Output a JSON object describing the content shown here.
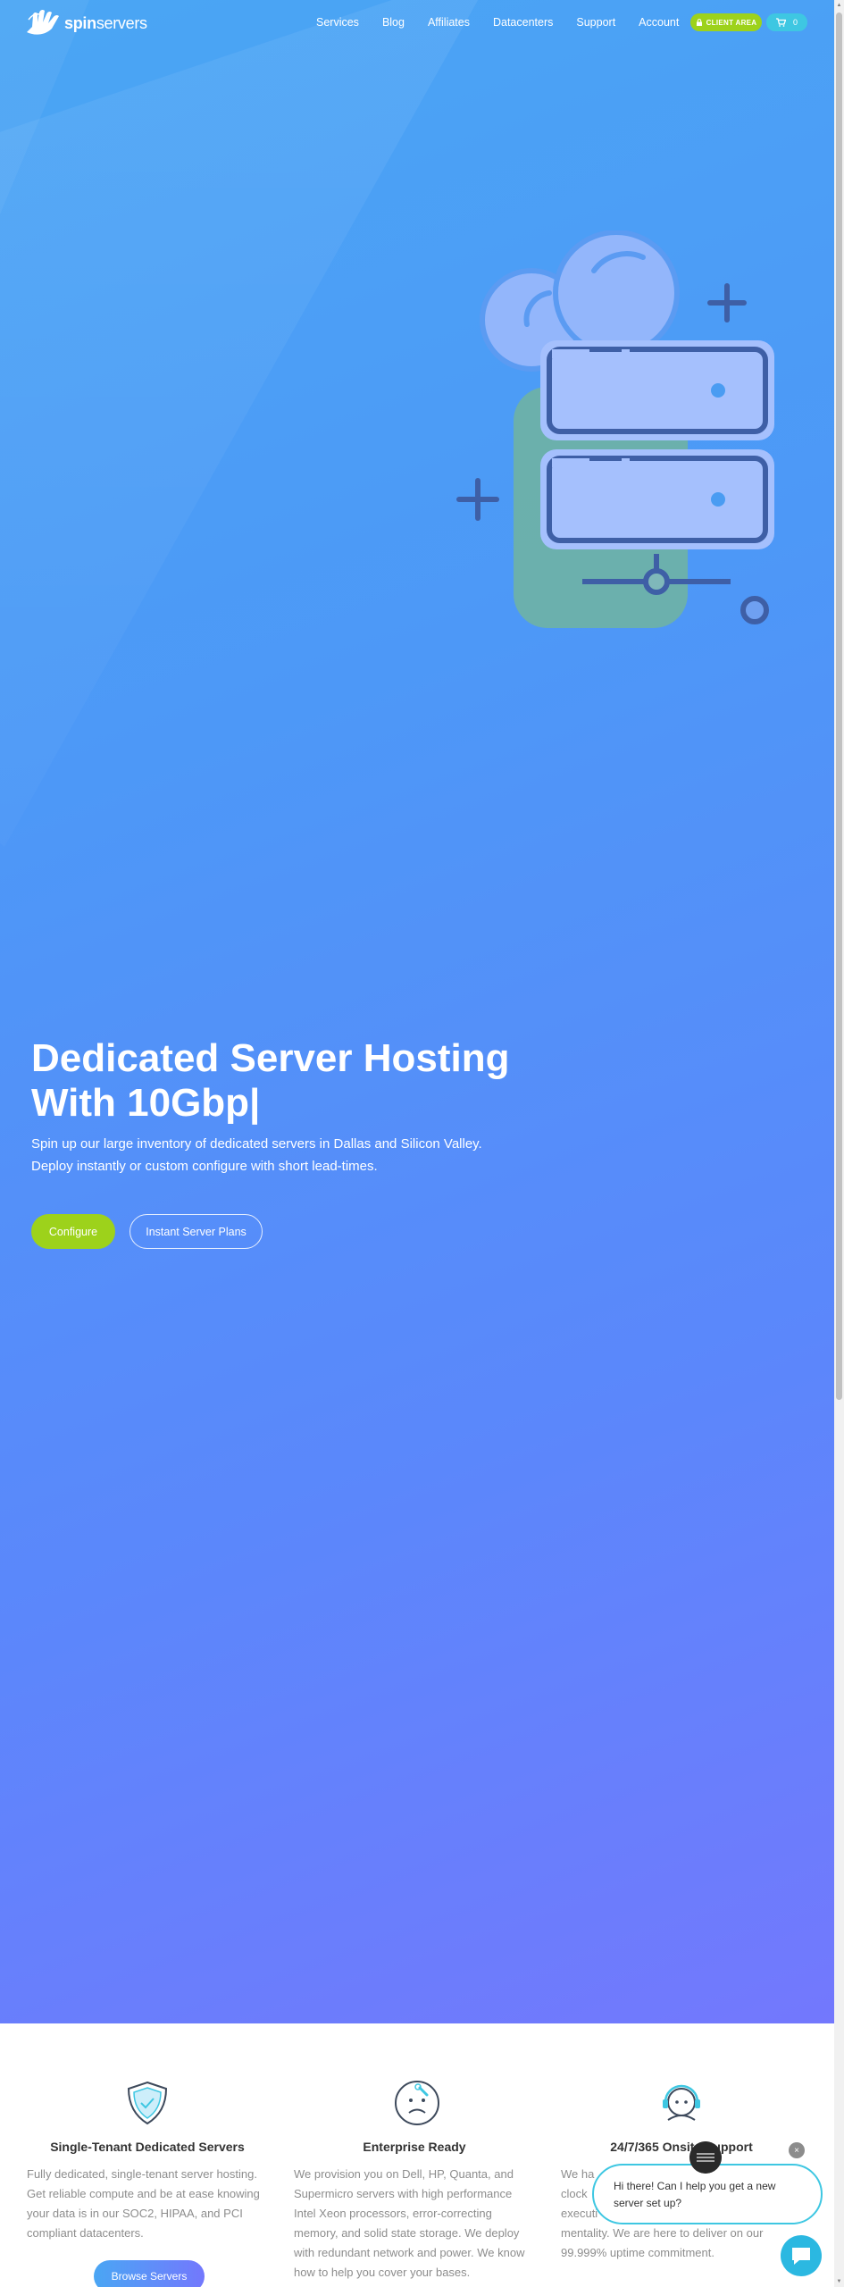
{
  "brand": {
    "name_bold": "spin",
    "name_light": "servers",
    "accent_color": "#9dd21b",
    "cyan_color": "#3ec7e2"
  },
  "nav": {
    "links": [
      "Services",
      "Blog",
      "Affiliates",
      "Datacenters",
      "Support",
      "Account"
    ],
    "client_area": "CLIENT AREA",
    "cart_count": "0"
  },
  "hero": {
    "title_line1": "Dedicated Server Hosting",
    "title_line2": "With 10Gbp|",
    "subtitle_line1": "Spin up our large inventory of dedicated servers in Dallas and Silicon Valley.",
    "subtitle_line2": "Deploy instantly or custom configure with short lead-times.",
    "configure_label": "Configure",
    "plans_label": "Instant Server Plans"
  },
  "features": [
    {
      "icon": "shield-icon",
      "title": "Single-Tenant Dedicated Servers",
      "text": "Fully dedicated, single-tenant server hosting. Get reliable compute and be at ease knowing your data is in our SOC2, HIPAA, and PCI compliant datacenters."
    },
    {
      "icon": "wrench-face-icon",
      "title": "Enterprise Ready",
      "text": "We provision you on Dell, HP, Quanta, and Supermicro servers with high performance Intel Xeon processors, error-correcting memory, and solid state storage. We deploy with redundant network and power. We know how to help you cover your bases."
    },
    {
      "icon": "support-agent-icon",
      "title": "24/7/365 Onsite Support",
      "text_line1": "We ha",
      "text_line2": "clock",
      "text_line3": "executi",
      "text_line4": "mentality. We are here to deliver on our",
      "text_line5": "99.999% uptime commitment."
    }
  ],
  "browse_label": "Browse Servers",
  "chat": {
    "message_line1": "Hi there! Can I help you get a new",
    "message_line2": "server set up?",
    "close_symbol": "×"
  }
}
